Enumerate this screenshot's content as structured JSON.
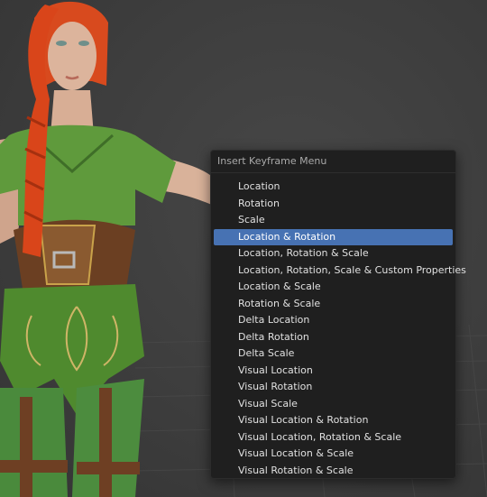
{
  "menu": {
    "title": "Insert Keyframe Menu",
    "active_index": 3,
    "items": [
      {
        "label": "Location"
      },
      {
        "label": "Rotation"
      },
      {
        "label": "Scale"
      },
      {
        "label": "Location & Rotation"
      },
      {
        "label": "Location, Rotation & Scale"
      },
      {
        "label": "Location, Rotation, Scale & Custom Properties"
      },
      {
        "label": "Location & Scale"
      },
      {
        "label": "Rotation & Scale"
      },
      {
        "label": "Delta Location"
      },
      {
        "label": "Delta Rotation"
      },
      {
        "label": "Delta Scale"
      },
      {
        "label": "Visual Location"
      },
      {
        "label": "Visual Rotation"
      },
      {
        "label": "Visual Scale"
      },
      {
        "label": "Visual Location & Rotation"
      },
      {
        "label": "Visual Location, Rotation & Scale"
      },
      {
        "label": "Visual Location & Scale"
      },
      {
        "label": "Visual Rotation & Scale"
      }
    ]
  },
  "colors": {
    "highlight": "#4772b3",
    "menu_bg": "#1f1f1f",
    "viewport_bg": "#3d3d3d"
  }
}
